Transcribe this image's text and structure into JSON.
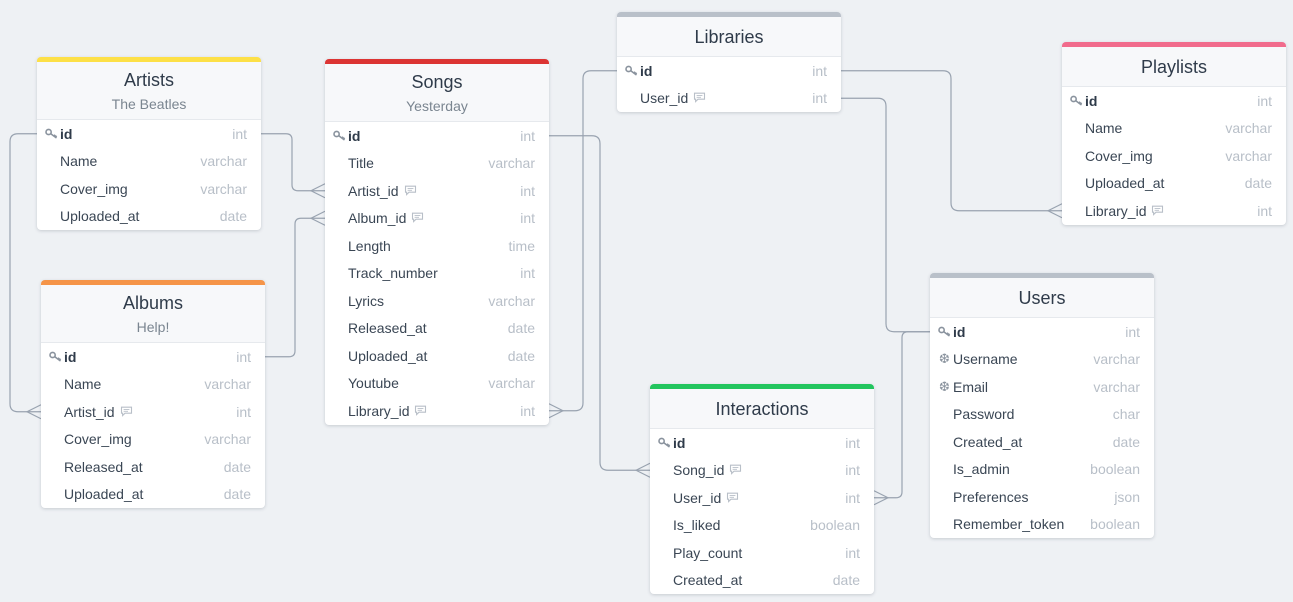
{
  "colors": {
    "background": "#eef1f4",
    "connector": "#99a3b0",
    "artists": "#fde047",
    "songs": "#dc3433",
    "libraries": "#b9c0c9",
    "playlists": "#f16b8c",
    "albums": "#f59448",
    "users": "#b9c0c9",
    "interactions": "#22c55e"
  },
  "tables": {
    "artists": {
      "title": "Artists",
      "subtitle": "The Beatles",
      "fields": [
        {
          "name": "id",
          "type": "int",
          "pk": true
        },
        {
          "name": "Name",
          "type": "varchar"
        },
        {
          "name": "Cover_img",
          "type": "varchar"
        },
        {
          "name": "Uploaded_at",
          "type": "date"
        }
      ]
    },
    "songs": {
      "title": "Songs",
      "subtitle": "Yesterday",
      "fields": [
        {
          "name": "id",
          "type": "int",
          "pk": true
        },
        {
          "name": "Title",
          "type": "varchar"
        },
        {
          "name": "Artist_id",
          "type": "int",
          "note": true
        },
        {
          "name": "Album_id",
          "type": "int",
          "note": true
        },
        {
          "name": "Length",
          "type": "time"
        },
        {
          "name": "Track_number",
          "type": "int"
        },
        {
          "name": "Lyrics",
          "type": "varchar"
        },
        {
          "name": "Released_at",
          "type": "date"
        },
        {
          "name": "Uploaded_at",
          "type": "date"
        },
        {
          "name": "Youtube",
          "type": "varchar"
        },
        {
          "name": "Library_id",
          "type": "int",
          "note": true
        }
      ]
    },
    "libraries": {
      "title": "Libraries",
      "fields": [
        {
          "name": "id",
          "type": "int",
          "pk": true
        },
        {
          "name": "User_id",
          "type": "int",
          "note": true
        }
      ]
    },
    "playlists": {
      "title": "Playlists",
      "fields": [
        {
          "name": "id",
          "type": "int",
          "pk": true
        },
        {
          "name": "Name",
          "type": "varchar"
        },
        {
          "name": "Cover_img",
          "type": "varchar"
        },
        {
          "name": "Uploaded_at",
          "type": "date"
        },
        {
          "name": "Library_id",
          "type": "int",
          "note": true
        }
      ]
    },
    "albums": {
      "title": "Albums",
      "subtitle": "Help!",
      "fields": [
        {
          "name": "id",
          "type": "int",
          "pk": true
        },
        {
          "name": "Name",
          "type": "varchar"
        },
        {
          "name": "Artist_id",
          "type": "int",
          "note": true
        },
        {
          "name": "Cover_img",
          "type": "varchar"
        },
        {
          "name": "Released_at",
          "type": "date"
        },
        {
          "name": "Uploaded_at",
          "type": "date"
        }
      ]
    },
    "users": {
      "title": "Users",
      "fields": [
        {
          "name": "id",
          "type": "int",
          "pk": true
        },
        {
          "name": "Username",
          "type": "varchar",
          "unique": true
        },
        {
          "name": "Email",
          "type": "varchar",
          "unique": true
        },
        {
          "name": "Password",
          "type": "char"
        },
        {
          "name": "Created_at",
          "type": "date"
        },
        {
          "name": "Is_admin",
          "type": "boolean"
        },
        {
          "name": "Preferences",
          "type": "json"
        },
        {
          "name": "Remember_token",
          "type": "boolean"
        }
      ]
    },
    "interactions": {
      "title": "Interactions",
      "fields": [
        {
          "name": "id",
          "type": "int",
          "pk": true
        },
        {
          "name": "Song_id",
          "type": "int",
          "note": true
        },
        {
          "name": "User_id",
          "type": "int",
          "note": true
        },
        {
          "name": "Is_liked",
          "type": "boolean"
        },
        {
          "name": "Play_count",
          "type": "int"
        },
        {
          "name": "Created_at",
          "type": "date"
        }
      ]
    }
  },
  "relationships": [
    {
      "from": "artists.id",
      "to": "songs.Artist_id",
      "cardinality": "one-to-many"
    },
    {
      "from": "artists.id",
      "to": "albums.Artist_id",
      "cardinality": "one-to-many"
    },
    {
      "from": "albums.id",
      "to": "songs.Album_id",
      "cardinality": "one-to-many"
    },
    {
      "from": "libraries.id",
      "to": "songs.Library_id",
      "cardinality": "one-to-many"
    },
    {
      "from": "libraries.id",
      "to": "playlists.Library_id",
      "cardinality": "one-to-many"
    },
    {
      "from": "users.id",
      "to": "libraries.User_id",
      "cardinality": "one-to-one"
    },
    {
      "from": "songs.id",
      "to": "interactions.Song_id",
      "cardinality": "one-to-many"
    },
    {
      "from": "users.id",
      "to": "interactions.User_id",
      "cardinality": "one-to-many"
    }
  ]
}
